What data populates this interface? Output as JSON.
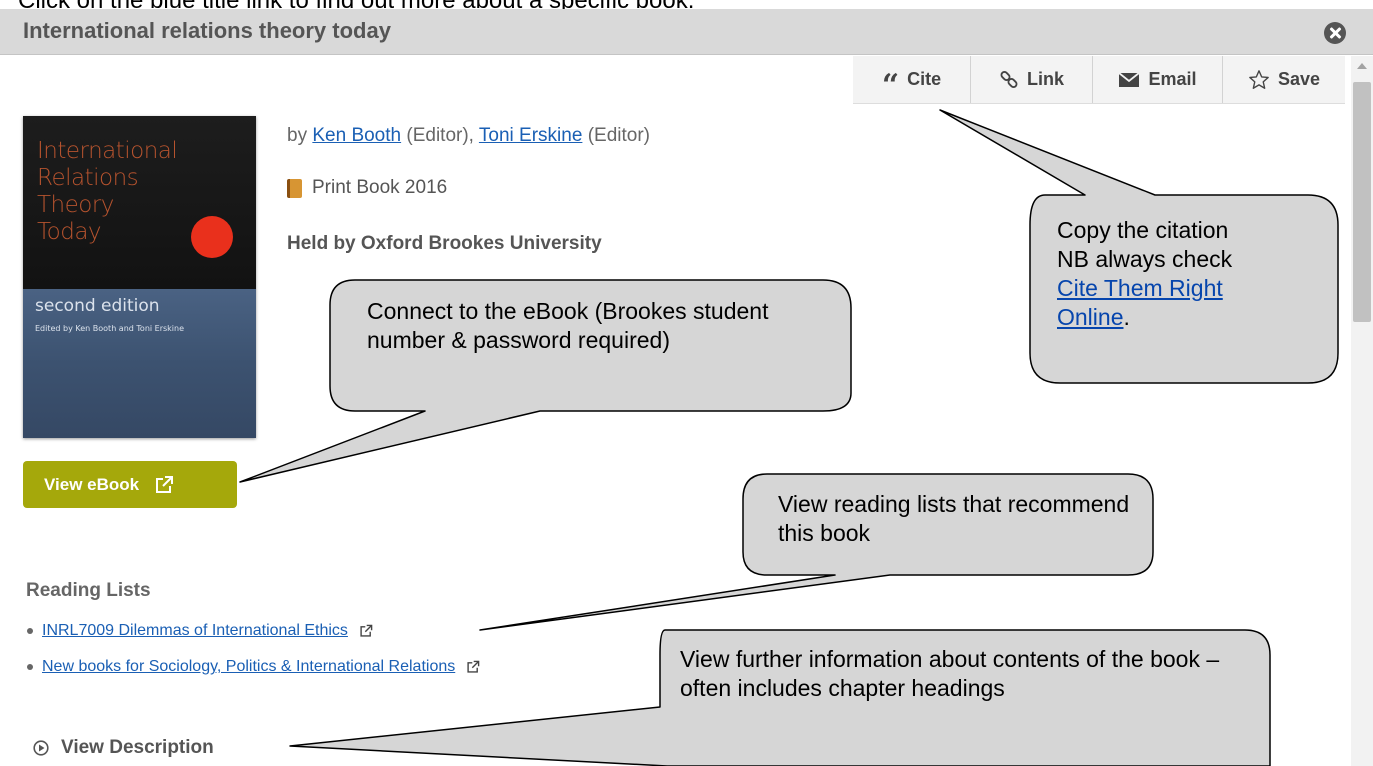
{
  "instruction": "Click on the blue title link to find out more about a specific book.",
  "panel": {
    "title": "International relations theory today",
    "close_icon": "close-circle-icon"
  },
  "actions": [
    {
      "label": "Cite",
      "icon": "quote-icon"
    },
    {
      "label": "Link",
      "icon": "link-icon"
    },
    {
      "label": "Email",
      "icon": "envelope-icon"
    },
    {
      "label": "Save",
      "icon": "star-icon"
    }
  ],
  "cover": {
    "title": "International\nRelations\nTheory\nToday",
    "edition": "second edition",
    "editors": "Edited by Ken Booth and Toni Erskine"
  },
  "record": {
    "by_prefix": "by",
    "author1": "Ken Booth",
    "author1_role": "(Editor),",
    "author2": "Toni Erskine",
    "author2_role": "(Editor)",
    "format": "Print Book 2016",
    "held_by": "Held by Oxford Brookes University"
  },
  "ebook_button": "View eBook",
  "reading_lists": {
    "heading": "Reading Lists",
    "items": [
      "INRL7009 Dilemmas of International Ethics",
      "New books for Sociology, Politics & International Relations"
    ]
  },
  "view_description": "View Description",
  "callouts": {
    "cite_line1": "Copy the citation",
    "cite_line2": "NB always check",
    "cite_link": "Cite Them Right Online",
    "cite_period": ".",
    "ebook": "Connect to the eBook (Brookes student number & password required)",
    "lists": "View reading lists that recommend this book",
    "description": "View further information about contents of the book – often includes chapter headings"
  },
  "colors": {
    "ebook_button": "#a5a80b",
    "link": "#1a5fb4",
    "title_bar": "#d9d9d9",
    "callout_fill": "#d6d6d6"
  }
}
